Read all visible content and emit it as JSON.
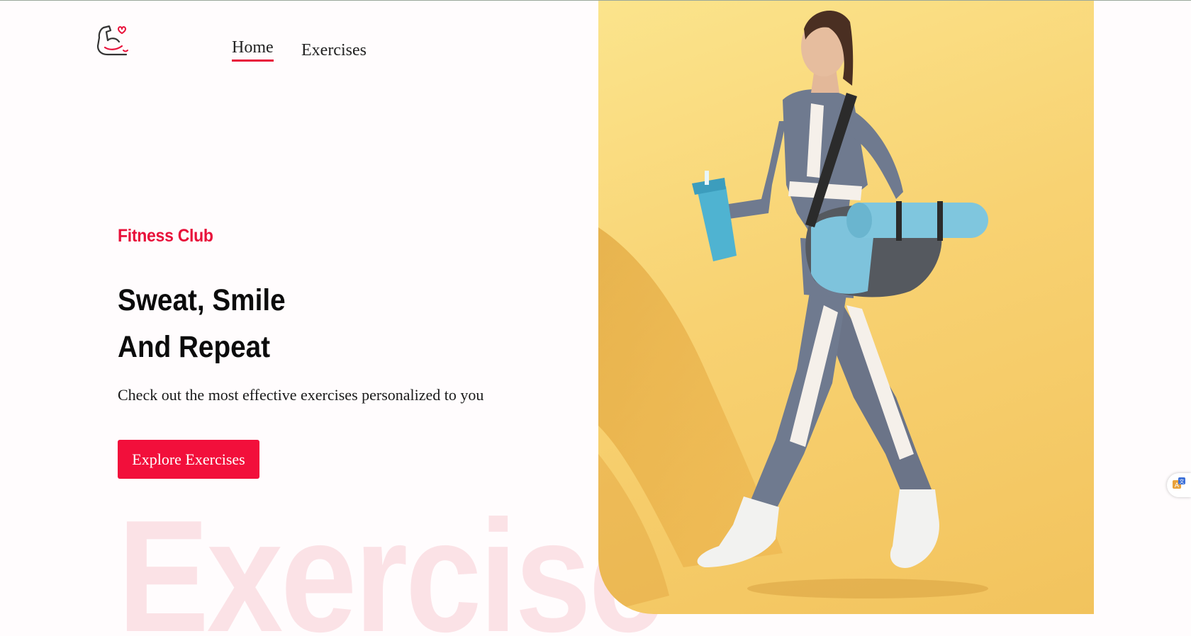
{
  "header": {
    "logo": "flexed-arm-heart-icon",
    "nav": {
      "home_label": "Home",
      "exercises_label": "Exercises"
    }
  },
  "hero": {
    "eyebrow": "Fitness Club",
    "headline_line1": "Sweat, Smile",
    "headline_line2": "And Repeat",
    "subtext": "Check out the most effective exercises personalized to you",
    "cta_label": "Explore Exercises",
    "background_word": "Exercise",
    "image": "woman-walking-with-gym-bag-and-shaker"
  },
  "widget": {
    "icon": "translate-icon"
  },
  "colors": {
    "accent": "#f20f3b",
    "background": "#fffcfd",
    "image_background": "#f8d272",
    "watermark": "#fbe2e6"
  }
}
